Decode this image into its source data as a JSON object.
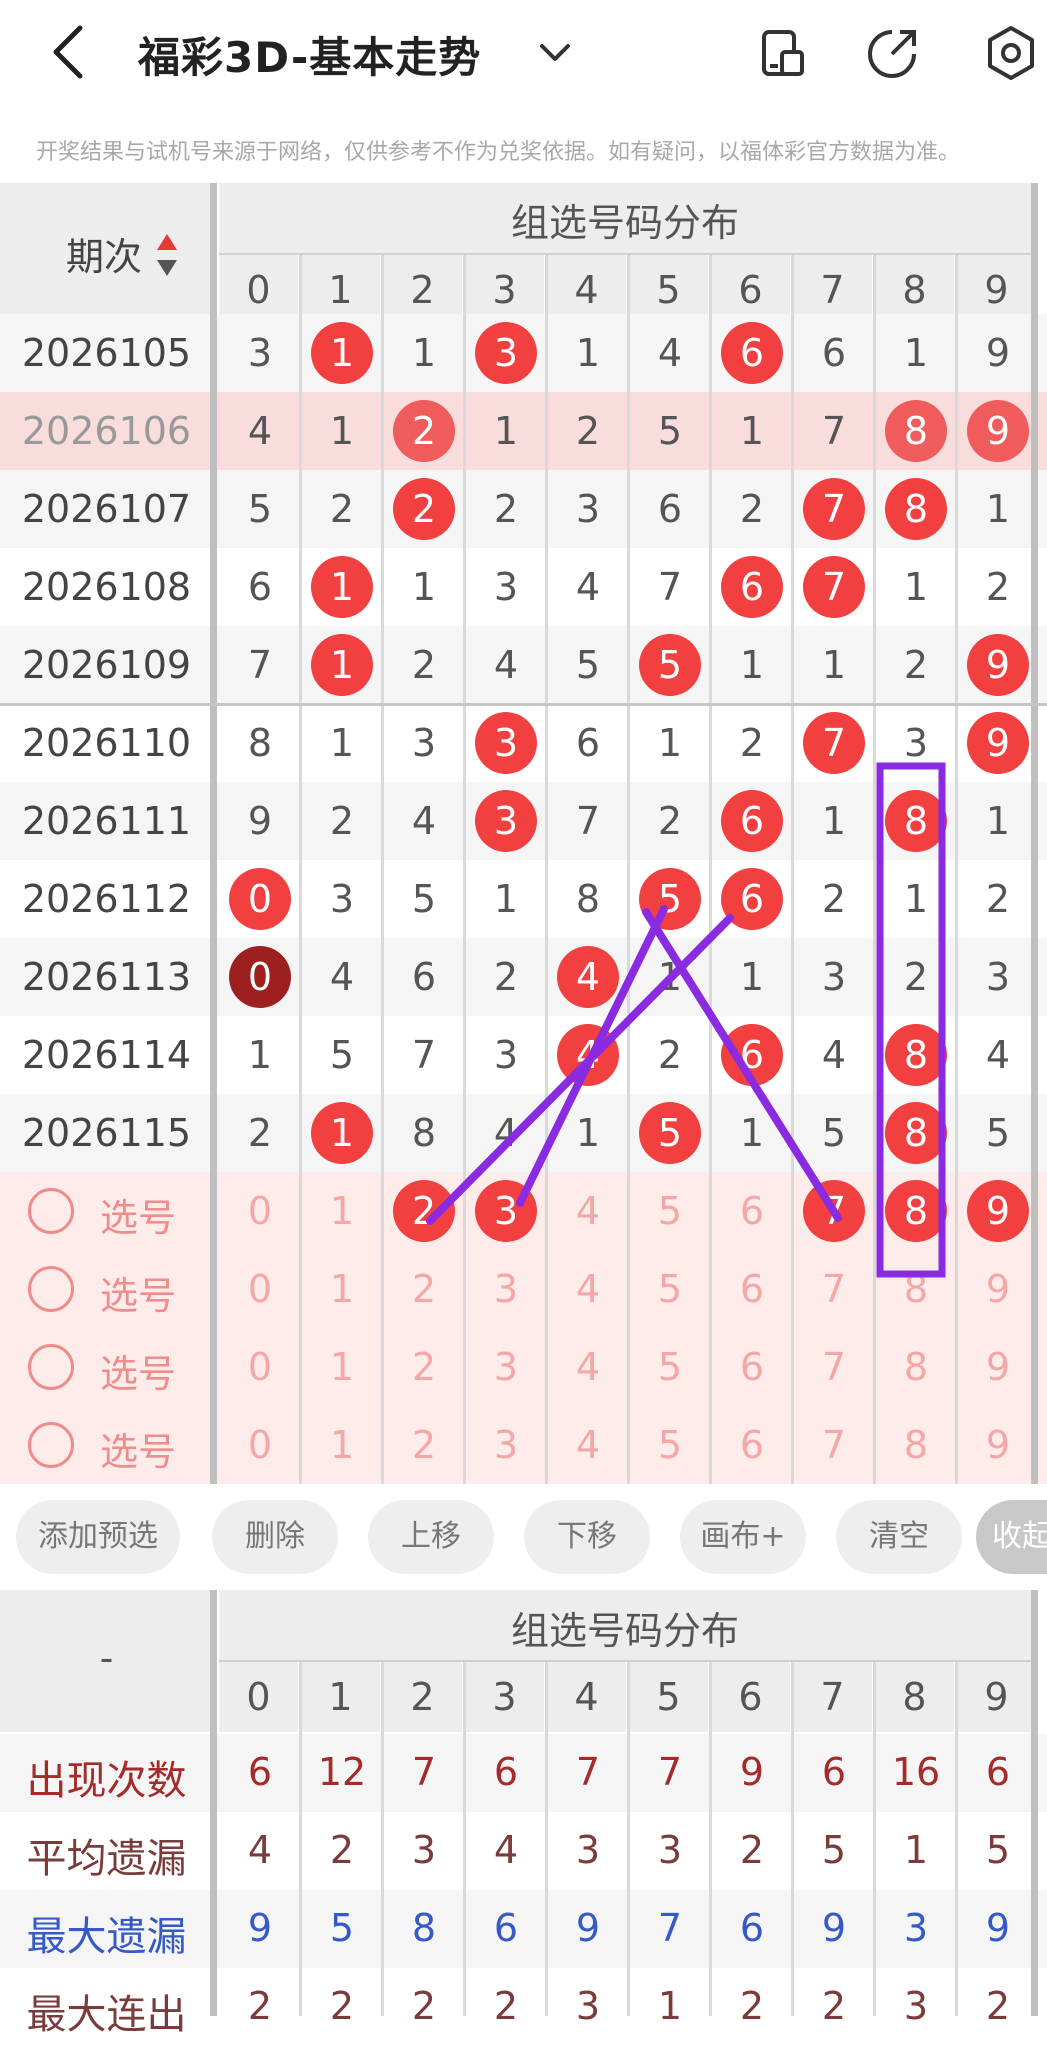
{
  "header": {
    "title": "福彩3D-基本走势",
    "notice": "开奖结果与试机号来源于网络，仅供参考不作为兑奖依据。如有疑问，以福体彩官方数据为准。"
  },
  "table": {
    "period_label": "期次",
    "group_title": "组选号码分布",
    "digits": [
      "0",
      "1",
      "2",
      "3",
      "4",
      "5",
      "6",
      "7",
      "8",
      "9"
    ],
    "rows": [
      {
        "period": "2026105",
        "cells": [
          "3",
          "1",
          "1",
          "3",
          "1",
          "4",
          "6",
          "6",
          "1",
          "9"
        ],
        "balls": [
          1,
          3,
          6
        ]
      },
      {
        "period": "2026106",
        "cells": [
          "4",
          "1",
          "2",
          "1",
          "2",
          "5",
          "1",
          "7",
          "8",
          "9"
        ],
        "balls": [
          2,
          8,
          9
        ],
        "highlight": true
      },
      {
        "period": "2026107",
        "cells": [
          "5",
          "2",
          "2",
          "2",
          "3",
          "6",
          "2",
          "7",
          "8",
          "1"
        ],
        "balls": [
          2,
          7,
          8
        ]
      },
      {
        "period": "2026108",
        "cells": [
          "6",
          "1",
          "1",
          "3",
          "4",
          "7",
          "6",
          "7",
          "1",
          "2"
        ],
        "balls": [
          1,
          6,
          7
        ]
      },
      {
        "period": "2026109",
        "cells": [
          "7",
          "1",
          "2",
          "4",
          "5",
          "5",
          "1",
          "1",
          "2",
          "9"
        ],
        "balls": [
          1,
          5,
          9
        ]
      },
      {
        "period": "2026110",
        "cells": [
          "8",
          "1",
          "3",
          "3",
          "6",
          "1",
          "2",
          "7",
          "3",
          "9"
        ],
        "balls": [
          3,
          7,
          9
        ]
      },
      {
        "period": "2026111",
        "cells": [
          "9",
          "2",
          "4",
          "3",
          "7",
          "2",
          "6",
          "1",
          "8",
          "1"
        ],
        "balls": [
          3,
          6,
          8
        ]
      },
      {
        "period": "2026112",
        "cells": [
          "0",
          "3",
          "5",
          "1",
          "8",
          "5",
          "6",
          "2",
          "1",
          "2"
        ],
        "balls": [
          0,
          5,
          6
        ]
      },
      {
        "period": "2026113",
        "cells": [
          "0",
          "4",
          "6",
          "2",
          "4",
          "1",
          "1",
          "3",
          "2",
          "3"
        ],
        "balls": [
          0,
          4
        ],
        "dark": [
          0
        ]
      },
      {
        "period": "2026114",
        "cells": [
          "1",
          "5",
          "7",
          "3",
          "4",
          "2",
          "6",
          "4",
          "8",
          "4"
        ],
        "balls": [
          4,
          6,
          8
        ]
      },
      {
        "period": "2026115",
        "cells": [
          "2",
          "1",
          "8",
          "4",
          "1",
          "5",
          "1",
          "5",
          "8",
          "5"
        ],
        "balls": [
          1,
          5,
          8
        ]
      }
    ],
    "pick_rows": [
      {
        "label": "选号",
        "balls": [
          2,
          3,
          7,
          8,
          9
        ]
      },
      {
        "label": "选号",
        "balls": []
      },
      {
        "label": "选号",
        "balls": []
      },
      {
        "label": "选号",
        "balls": []
      }
    ]
  },
  "toolbar": {
    "buttons": [
      "添加预选",
      "删除",
      "上移",
      "下移",
      "画布+",
      "清空",
      "收起"
    ]
  },
  "stats": {
    "corner": "-",
    "group_title": "组选号码分布",
    "rows": [
      {
        "label": "出现次数",
        "values": [
          "6",
          "12",
          "7",
          "6",
          "7",
          "7",
          "9",
          "6",
          "16",
          "6"
        ],
        "color": "#a52a2a"
      },
      {
        "label": "平均遗漏",
        "values": [
          "4",
          "2",
          "3",
          "4",
          "3",
          "3",
          "2",
          "5",
          "1",
          "5"
        ],
        "color": "#7a3b3b"
      },
      {
        "label": "最大遗漏",
        "values": [
          "9",
          "5",
          "8",
          "6",
          "9",
          "7",
          "6",
          "9",
          "3",
          "9"
        ],
        "color": "#3559c7"
      },
      {
        "label": "最大连出",
        "values": [
          "2",
          "2",
          "2",
          "2",
          "3",
          "1",
          "2",
          "2",
          "3",
          "2"
        ],
        "color": "#7a3b3b"
      }
    ]
  },
  "colors": {
    "ball": "#f23f3f",
    "pick_text": "#f3a7a7",
    "drawing": "#8a2be2"
  }
}
